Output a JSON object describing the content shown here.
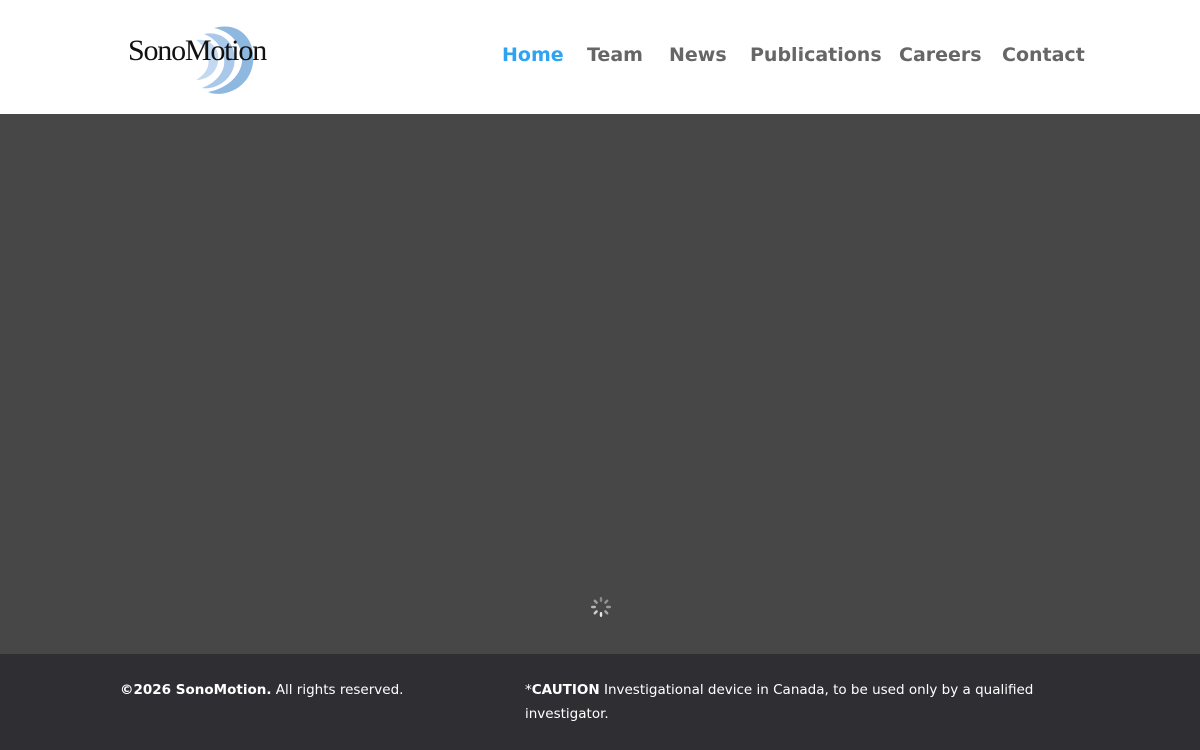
{
  "brand": {
    "name": "SonoMotion",
    "logo_icon": "concentric-waves-logo",
    "accent_color": "#2ea3f2",
    "logo_wave_color": "#8fb8e0"
  },
  "nav": {
    "items": [
      {
        "label": "Home",
        "active": true
      },
      {
        "label": "Team",
        "active": false
      },
      {
        "label": "News",
        "active": false
      },
      {
        "label": "Publications",
        "active": false
      },
      {
        "label": "Careers",
        "active": false
      },
      {
        "label": "Contact",
        "active": false
      }
    ]
  },
  "hero": {
    "background_color": "#474747",
    "loading_indicator": "spinner-icon"
  },
  "footer": {
    "background_color": "#2e2e33",
    "copyright_strong": "©2026 SonoMotion.",
    "copyright_rest": " All rights reserved.",
    "caution_prefix": "*",
    "caution_strong": "CAUTION",
    "caution_text": " Investigational device in Canada, to be used only by a qualified investigator."
  }
}
